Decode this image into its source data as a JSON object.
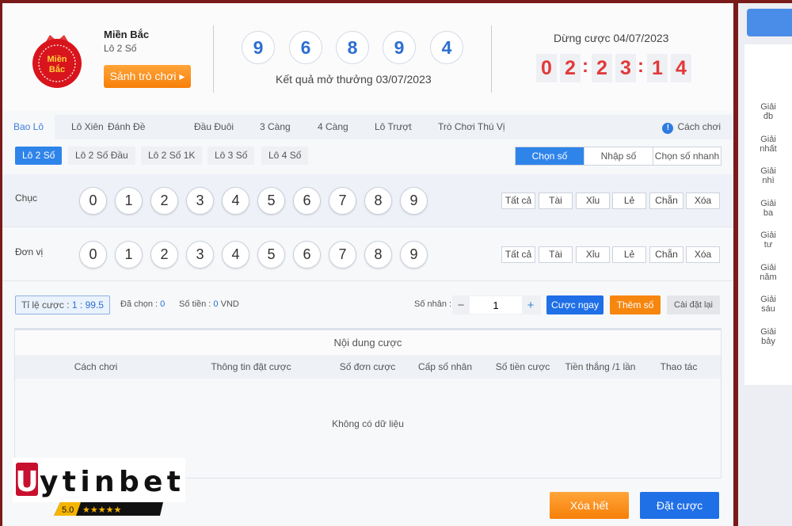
{
  "game": {
    "name": "Miền Bắc",
    "subtitle": "Lô 2 Số",
    "logo_text": "Miền Bắc",
    "lobby_button": "Sảnh trò chơi ▸"
  },
  "result": {
    "numbers": [
      "9",
      "6",
      "8",
      "9",
      "4"
    ],
    "label": "Kết quả mở thưởng 03/07/2023"
  },
  "countdown": {
    "label": "Dừng cược 04/07/2023",
    "digits": [
      "0",
      "2",
      "2",
      "3",
      "1",
      "4"
    ]
  },
  "tabs": [
    {
      "label": "Bao Lô",
      "active": true
    },
    {
      "label": "Lô Xiên"
    },
    {
      "label": "Đánh Đề"
    },
    {
      "label": "Đầu Đuôi"
    },
    {
      "label": "3 Càng"
    },
    {
      "label": "4 Càng"
    },
    {
      "label": "Lô Trượt"
    },
    {
      "label": "Trò Chơi Thú Vị"
    }
  ],
  "how_to_play": "Cách chơi",
  "subtabs": [
    {
      "label": "Lô 2 Số",
      "active": true
    },
    {
      "label": "Lô 2 Số Đầu"
    },
    {
      "label": "Lô 2 Số 1K"
    },
    {
      "label": "Lô 3 Số"
    },
    {
      "label": "Lô 4 Số"
    }
  ],
  "modes": [
    {
      "label": "Chọn số",
      "active": true
    },
    {
      "label": "Nhập số"
    },
    {
      "label": "Chọn số nhanh"
    }
  ],
  "rows": [
    {
      "label": "Chục"
    },
    {
      "label": "Đơn vị"
    }
  ],
  "digits": [
    "0",
    "1",
    "2",
    "3",
    "4",
    "5",
    "6",
    "7",
    "8",
    "9"
  ],
  "quick": [
    "Tất cả",
    "Tài",
    "Xỉu",
    "Lẻ",
    "Chẵn",
    "Xóa"
  ],
  "bet": {
    "ratio_label": "Tỉ lệ cược : ",
    "ratio": "1 : 99.5",
    "selected_label": "Đã chọn : ",
    "selected": "0",
    "amount_label": "Số tiền : ",
    "amount": "0",
    "currency": " VND",
    "multiplier_label": "Số nhân :",
    "multiplier": "1",
    "bet_now": "Cược ngay",
    "add_number": "Thêm số",
    "reset": "Cài đặt lại"
  },
  "table": {
    "title": "Nội dung cược",
    "columns": [
      "Cách chơi",
      "Thông tin đặt cược",
      "Số đơn cược",
      "Cấp số nhân",
      "Số tiền cược",
      "Tiền thắng /1 lần",
      "Thao tác"
    ],
    "empty": "Không có dữ liệu"
  },
  "actions": {
    "clear_all": "Xóa hết",
    "place_bet": "Đặt cược"
  },
  "sidebar": {
    "prizes": [
      "Giải đb",
      "Giải nhất",
      "Giải nhì",
      "Giải ba",
      "Giải tư",
      "Giải năm",
      "Giải sáu",
      "Giải bảy"
    ]
  },
  "watermark": {
    "text": "Uytinbet",
    "rating": "5.0",
    "stars": "★★★★★"
  },
  "colors": {
    "accent": "#2f84ea",
    "orange": "#f7860e",
    "countdown": "#e03a3a",
    "frame": "#7a1a1a"
  }
}
